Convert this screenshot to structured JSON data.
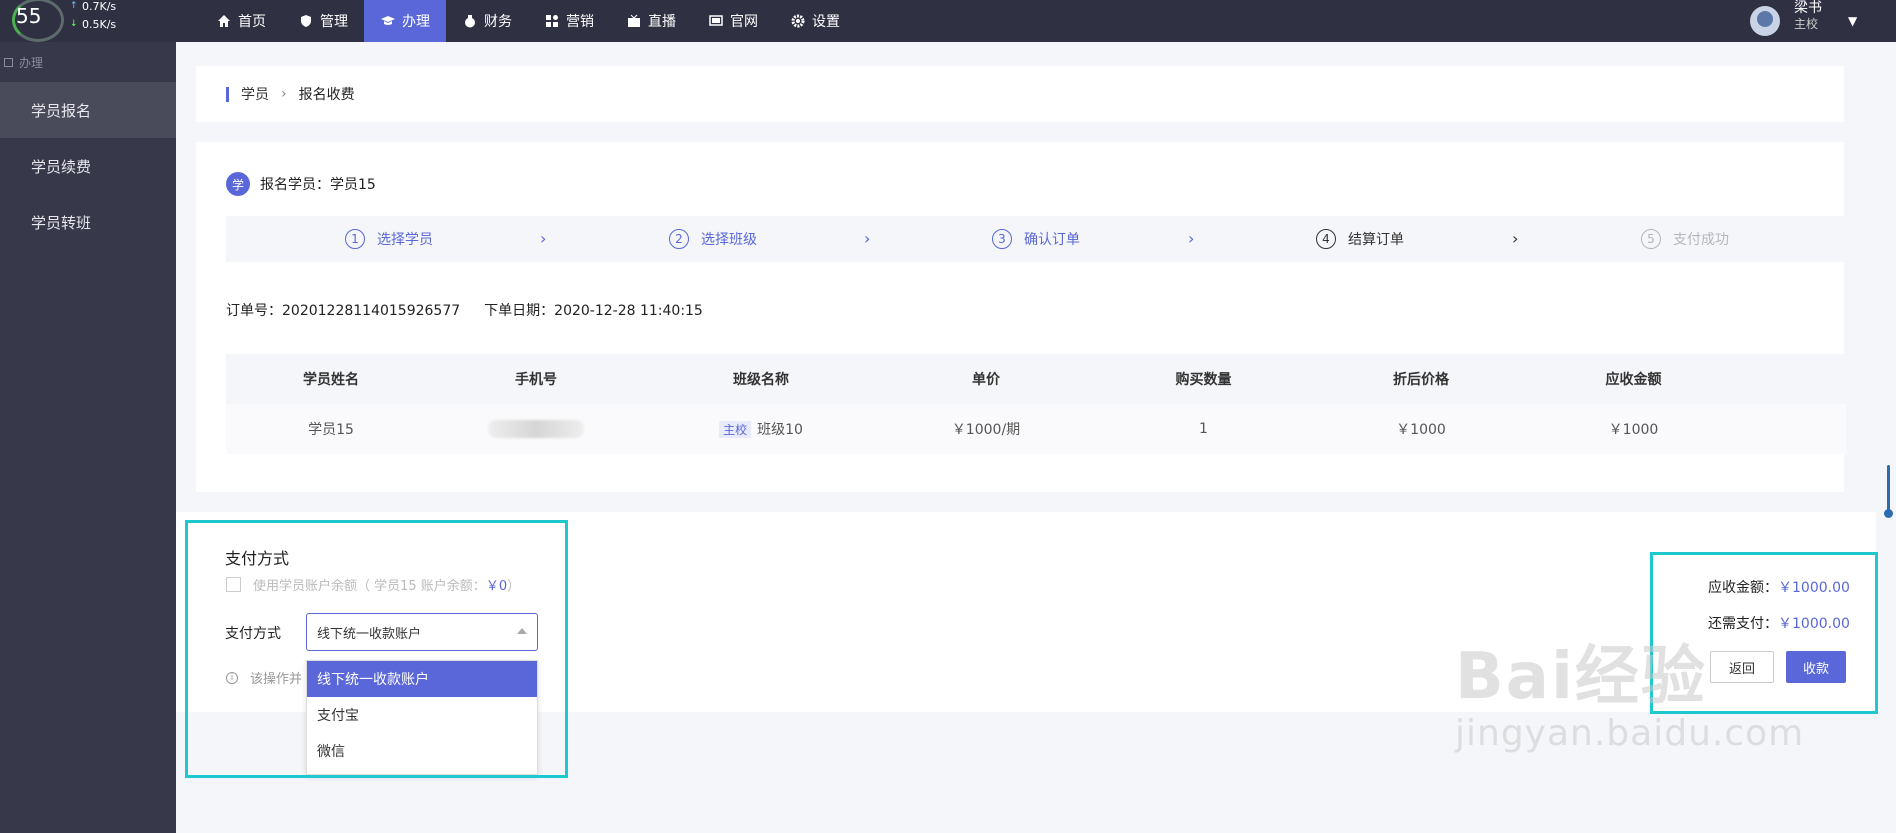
{
  "sysmon": {
    "percent": "55",
    "up": "0.7K/s",
    "down": "0.5K/s"
  },
  "nav": {
    "items": [
      {
        "label": "首页",
        "icon": "home-icon"
      },
      {
        "label": "管理",
        "icon": "shield-icon"
      },
      {
        "label": "办理",
        "icon": "graduation-cap-icon",
        "active": true
      },
      {
        "label": "财务",
        "icon": "money-bag-icon"
      },
      {
        "label": "营销",
        "icon": "grid-icon"
      },
      {
        "label": "直播",
        "icon": "tv-icon"
      },
      {
        "label": "官网",
        "icon": "monitor-icon"
      },
      {
        "label": "设置",
        "icon": "gear-icon"
      }
    ]
  },
  "user": {
    "name": "梁书",
    "role": "主校"
  },
  "sidebar": {
    "title": "办理",
    "items": [
      {
        "label": "学员报名",
        "active": true
      },
      {
        "label": "学员续费"
      },
      {
        "label": "学员转班"
      }
    ]
  },
  "breadcrumb": {
    "root": "学员",
    "current": "报名收费"
  },
  "order": {
    "student_badge": "学",
    "student_label": "报名学员：学员15",
    "steps": [
      {
        "num": "1",
        "label": "选择学员",
        "state": "done"
      },
      {
        "num": "2",
        "label": "选择班级",
        "state": "done"
      },
      {
        "num": "3",
        "label": "确认订单",
        "state": "done"
      },
      {
        "num": "4",
        "label": "结算订单",
        "state": "current"
      },
      {
        "num": "5",
        "label": "支付成功",
        "state": "todo"
      }
    ],
    "order_no": "订单号：20201228114015926577",
    "order_date": "下单日期：2020-12-28 11:40:15",
    "table": {
      "headers": [
        "学员姓名",
        "手机号",
        "班级名称",
        "单价",
        "购买数量",
        "折后价格",
        "应收金额"
      ],
      "row": {
        "name": "学员15",
        "phone": "",
        "class_tag": "主校",
        "class_name": "班级10",
        "unit_price": "￥1000/期",
        "qty": "1",
        "discount_price": "￥1000",
        "receivable": "￥1000"
      }
    }
  },
  "payment": {
    "title": "支付方式",
    "balance_text": "使用学员账户余额（ 学员15 账户余额：",
    "balance_amount": "￥0",
    "balance_close": "）",
    "method_label": "支付方式",
    "selected": "线下统一收款账户",
    "info_text": "该操作并",
    "options": [
      "线下统一收款账户",
      "支付宝",
      "微信"
    ]
  },
  "summary": {
    "receivable_label": "应收金额：",
    "receivable_value": "￥1000.00",
    "remaining_label": "还需支付：",
    "remaining_value": "￥1000.00",
    "back_label": "返回",
    "collect_label": "收款"
  },
  "watermark": {
    "logo": "Bai经验",
    "url": "jingyan.baidu.com"
  },
  "colors": {
    "accent": "#5a67d8",
    "highlight": "#1ec8cf",
    "topbar": "#2f3042",
    "sidebar": "#373849"
  }
}
